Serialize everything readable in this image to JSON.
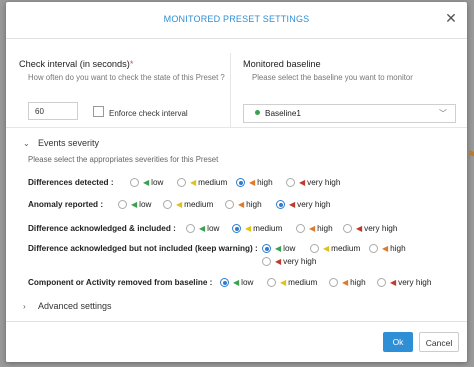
{
  "dialog": {
    "title": "MONITORED PRESET SETTINGS",
    "close_icon": "close-icon"
  },
  "check_interval": {
    "label": "Check interval (in seconds)",
    "required_mark": "*",
    "hint": "How often do you want to check the state of this Preset ?",
    "value": "60",
    "enforce_label": "Enforce check interval",
    "enforce_checked": false
  },
  "baseline": {
    "label": "Monitored baseline",
    "hint": "Please select the baseline you want to monitor",
    "selected": "Baseline1",
    "status_color": "#3aa14f"
  },
  "events": {
    "title": "Events severity",
    "hint": "Please select the appropriates severities for this Preset",
    "expanded": true,
    "severity_labels": {
      "low": "low",
      "medium": "medium",
      "high": "high",
      "very_high": "very high"
    },
    "severity_colors": {
      "low": "#3aa14f",
      "medium": "#e0c21a",
      "high": "#e07a2a",
      "very_high": "#c0392b"
    },
    "rows": [
      {
        "label": "Differences detected :",
        "selected": "high"
      },
      {
        "label": "Anomaly reported :",
        "selected": "very_high"
      },
      {
        "label": "Difference acknowledged & included :",
        "selected": "medium"
      },
      {
        "label": "Difference acknowledged but not included (keep warning) :",
        "selected": "low"
      },
      {
        "label": "Component or Activity removed from baseline :",
        "selected": "low"
      }
    ]
  },
  "advanced": {
    "title": "Advanced settings",
    "expanded": false
  },
  "footer": {
    "ok_label": "Ok",
    "cancel_label": "Cancel"
  }
}
